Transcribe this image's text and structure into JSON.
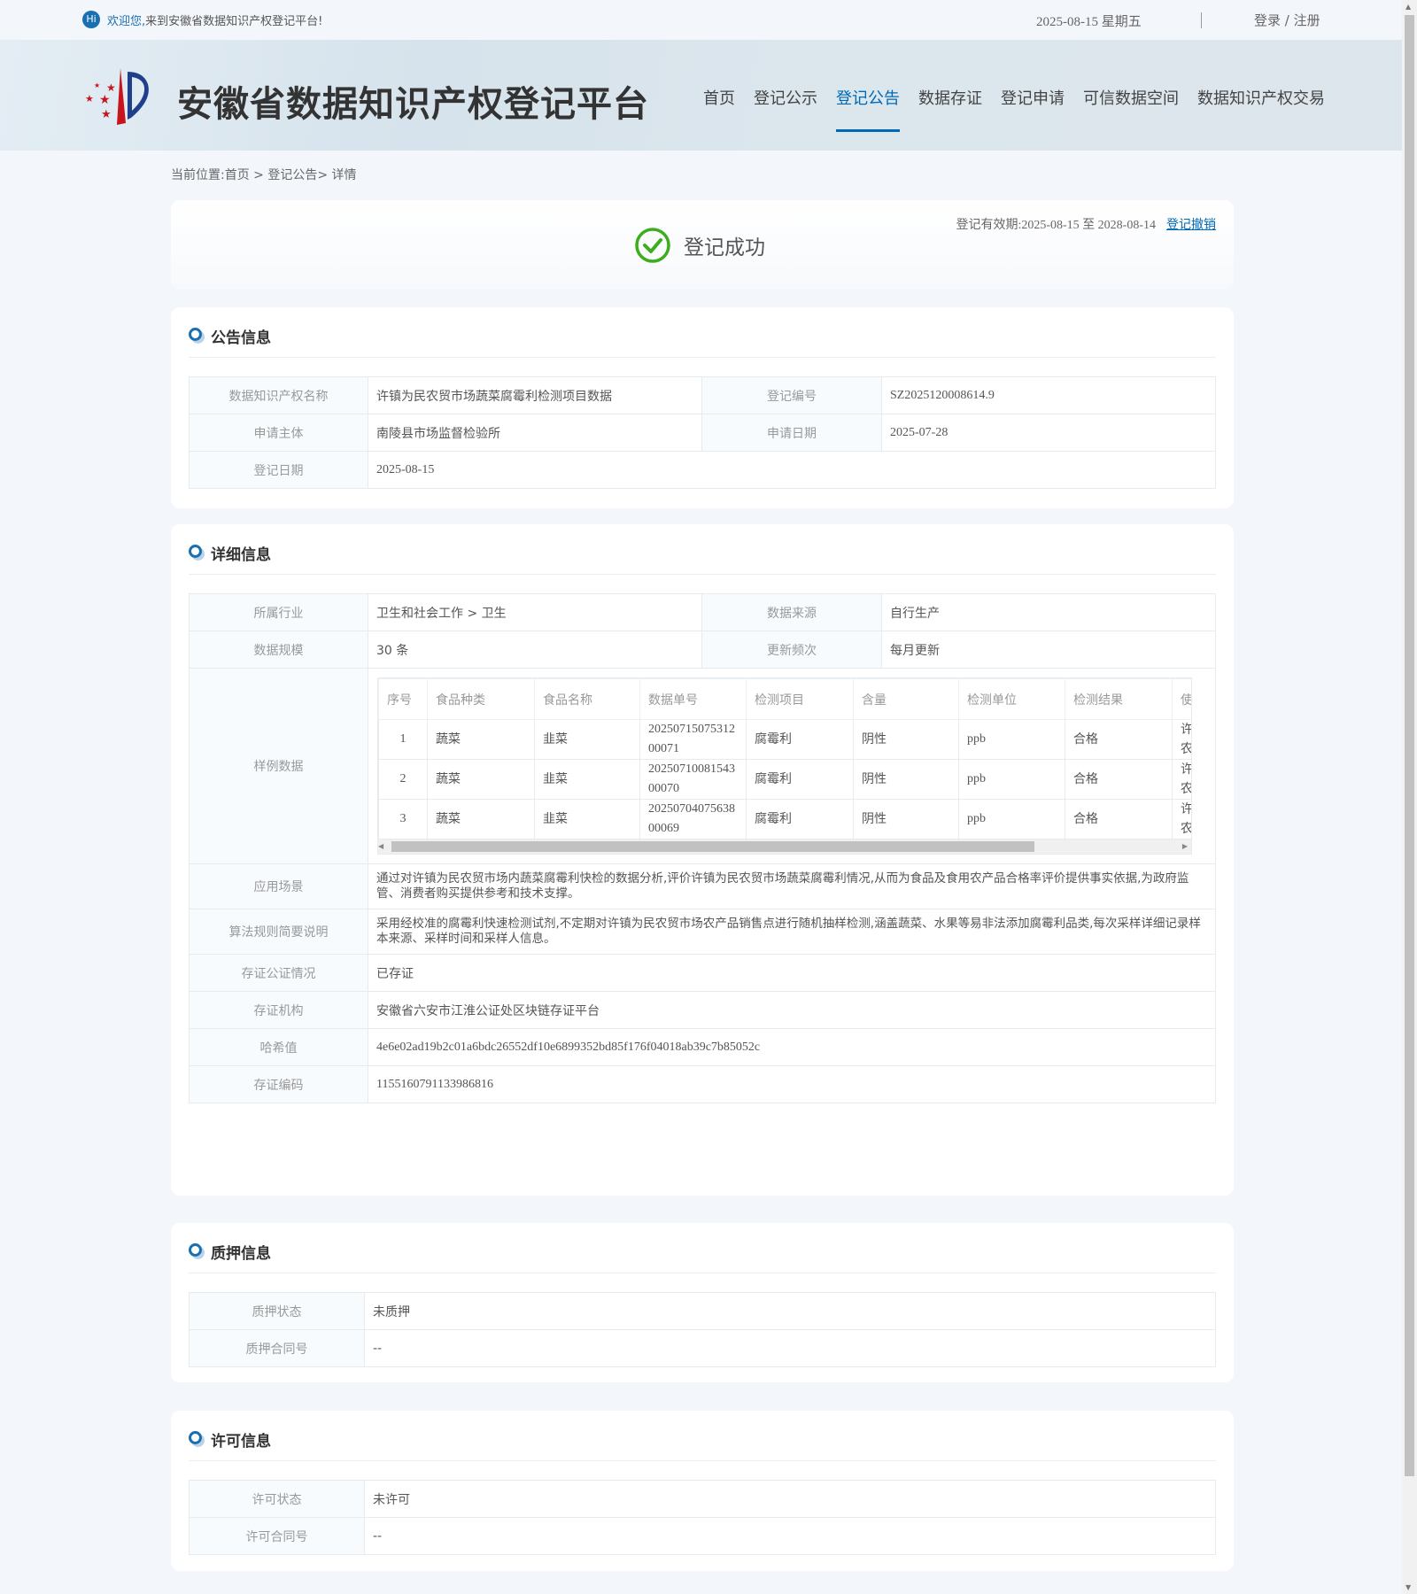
{
  "topbar": {
    "hi": "Hi",
    "welcome_blue": "欢迎您,",
    "welcome_rest": "来到安徽省数据知识产权登记平台!",
    "date": "2025-08-15 星期五",
    "login": "登录",
    "slash": " / ",
    "register": "注册"
  },
  "header": {
    "title": "安徽省数据知识产权登记平台",
    "nav": [
      "首页",
      "登记公示",
      "登记公告",
      "数据存证",
      "登记申请",
      "可信数据空间",
      "数据知识产权交易"
    ],
    "active": "登记公告"
  },
  "breadcrumb": {
    "prefix": "当前位置:",
    "home": "首页",
    "sep": " > ",
    "section": "登记公告",
    "sep2": "> ",
    "current": "详情"
  },
  "status": {
    "text": "登记成功",
    "validity_label": "登记有效期:",
    "validity": "2025-08-15 至 2028-08-14",
    "revoke": "登记撤销",
    "color": "#3cae1e"
  },
  "announcement": {
    "title": "公告信息",
    "name_label": "数据知识产权名称",
    "name": "许镇为民农贸市场蔬菜腐霉利检测项目数据",
    "no_label": "登记编号",
    "no": "SZ2025120008614.9",
    "applicant_label": "申请主体",
    "applicant": "南陵县市场监督检验所",
    "apply_date_label": "申请日期",
    "apply_date": "2025-07-28",
    "reg_date_label": "登记日期",
    "reg_date": "2025-08-15"
  },
  "detail": {
    "title": "详细信息",
    "industry_label": "所属行业",
    "industry": "卫生和社会工作 > 卫生",
    "source_label": "数据来源",
    "source": "自行生产",
    "scale_label": "数据规模",
    "scale": "30 条",
    "freq_label": "更新频次",
    "freq": "每月更新",
    "sample_label": "样例数据",
    "sample": {
      "headers": [
        "序号",
        "食品种类",
        "食品名称",
        "数据单号",
        "检测项目",
        "含量",
        "检测单位",
        "检测结果",
        "使用"
      ],
      "rows": [
        [
          "1",
          "蔬菜",
          "韭菜",
          "2025071507531200071",
          "腐霉利",
          "阴性",
          "ppb",
          "合格",
          "许镇为民农贸市场"
        ],
        [
          "2",
          "蔬菜",
          "韭菜",
          "2025071008154300070",
          "腐霉利",
          "阴性",
          "ppb",
          "合格",
          "许镇为民农贸市场"
        ],
        [
          "3",
          "蔬菜",
          "韭菜",
          "2025070407563800069",
          "腐霉利",
          "阴性",
          "ppb",
          "合格",
          "许镇为民农贸市场"
        ]
      ]
    },
    "scenario_label": "应用场景",
    "scenario": "通过对许镇为民农贸市场内蔬菜腐霉利快检的数据分析,评价许镇为民农贸市场蔬菜腐霉利情况,从而为食品及食用农产品合格率评价提供事实依据,为政府监管、消费者购买提供参考和技术支撑。",
    "algo_label": "算法规则简要说明",
    "algo": "采用经校准的腐霉利快速检测试剂,不定期对许镇为民农贸市场农产品销售点进行随机抽样检测,涵盖蔬菜、水果等易非法添加腐霉利品类,每次采样详细记录样本来源、采样时间和采样人信息。",
    "notary_label": "存证公证情况",
    "notary": "已存证",
    "org_label": "存证机构",
    "org": "安徽省六安市江淮公证处区块链存证平台",
    "hash_label": "哈希值",
    "hash": "4e6e02ad19b2c01a6bdc26552df10e6899352bd85f176f04018ab39c7b85052c",
    "code_label": "存证编码",
    "code": "1155160791133986816"
  },
  "pledge": {
    "title": "质押信息",
    "status_label": "质押状态",
    "status": "未质押",
    "contract_label": "质押合同号",
    "contract": "--"
  },
  "license": {
    "title": "许可信息",
    "status_label": "许可状态",
    "status": "未许可",
    "contract_label": "许可合同号",
    "contract": "--"
  }
}
